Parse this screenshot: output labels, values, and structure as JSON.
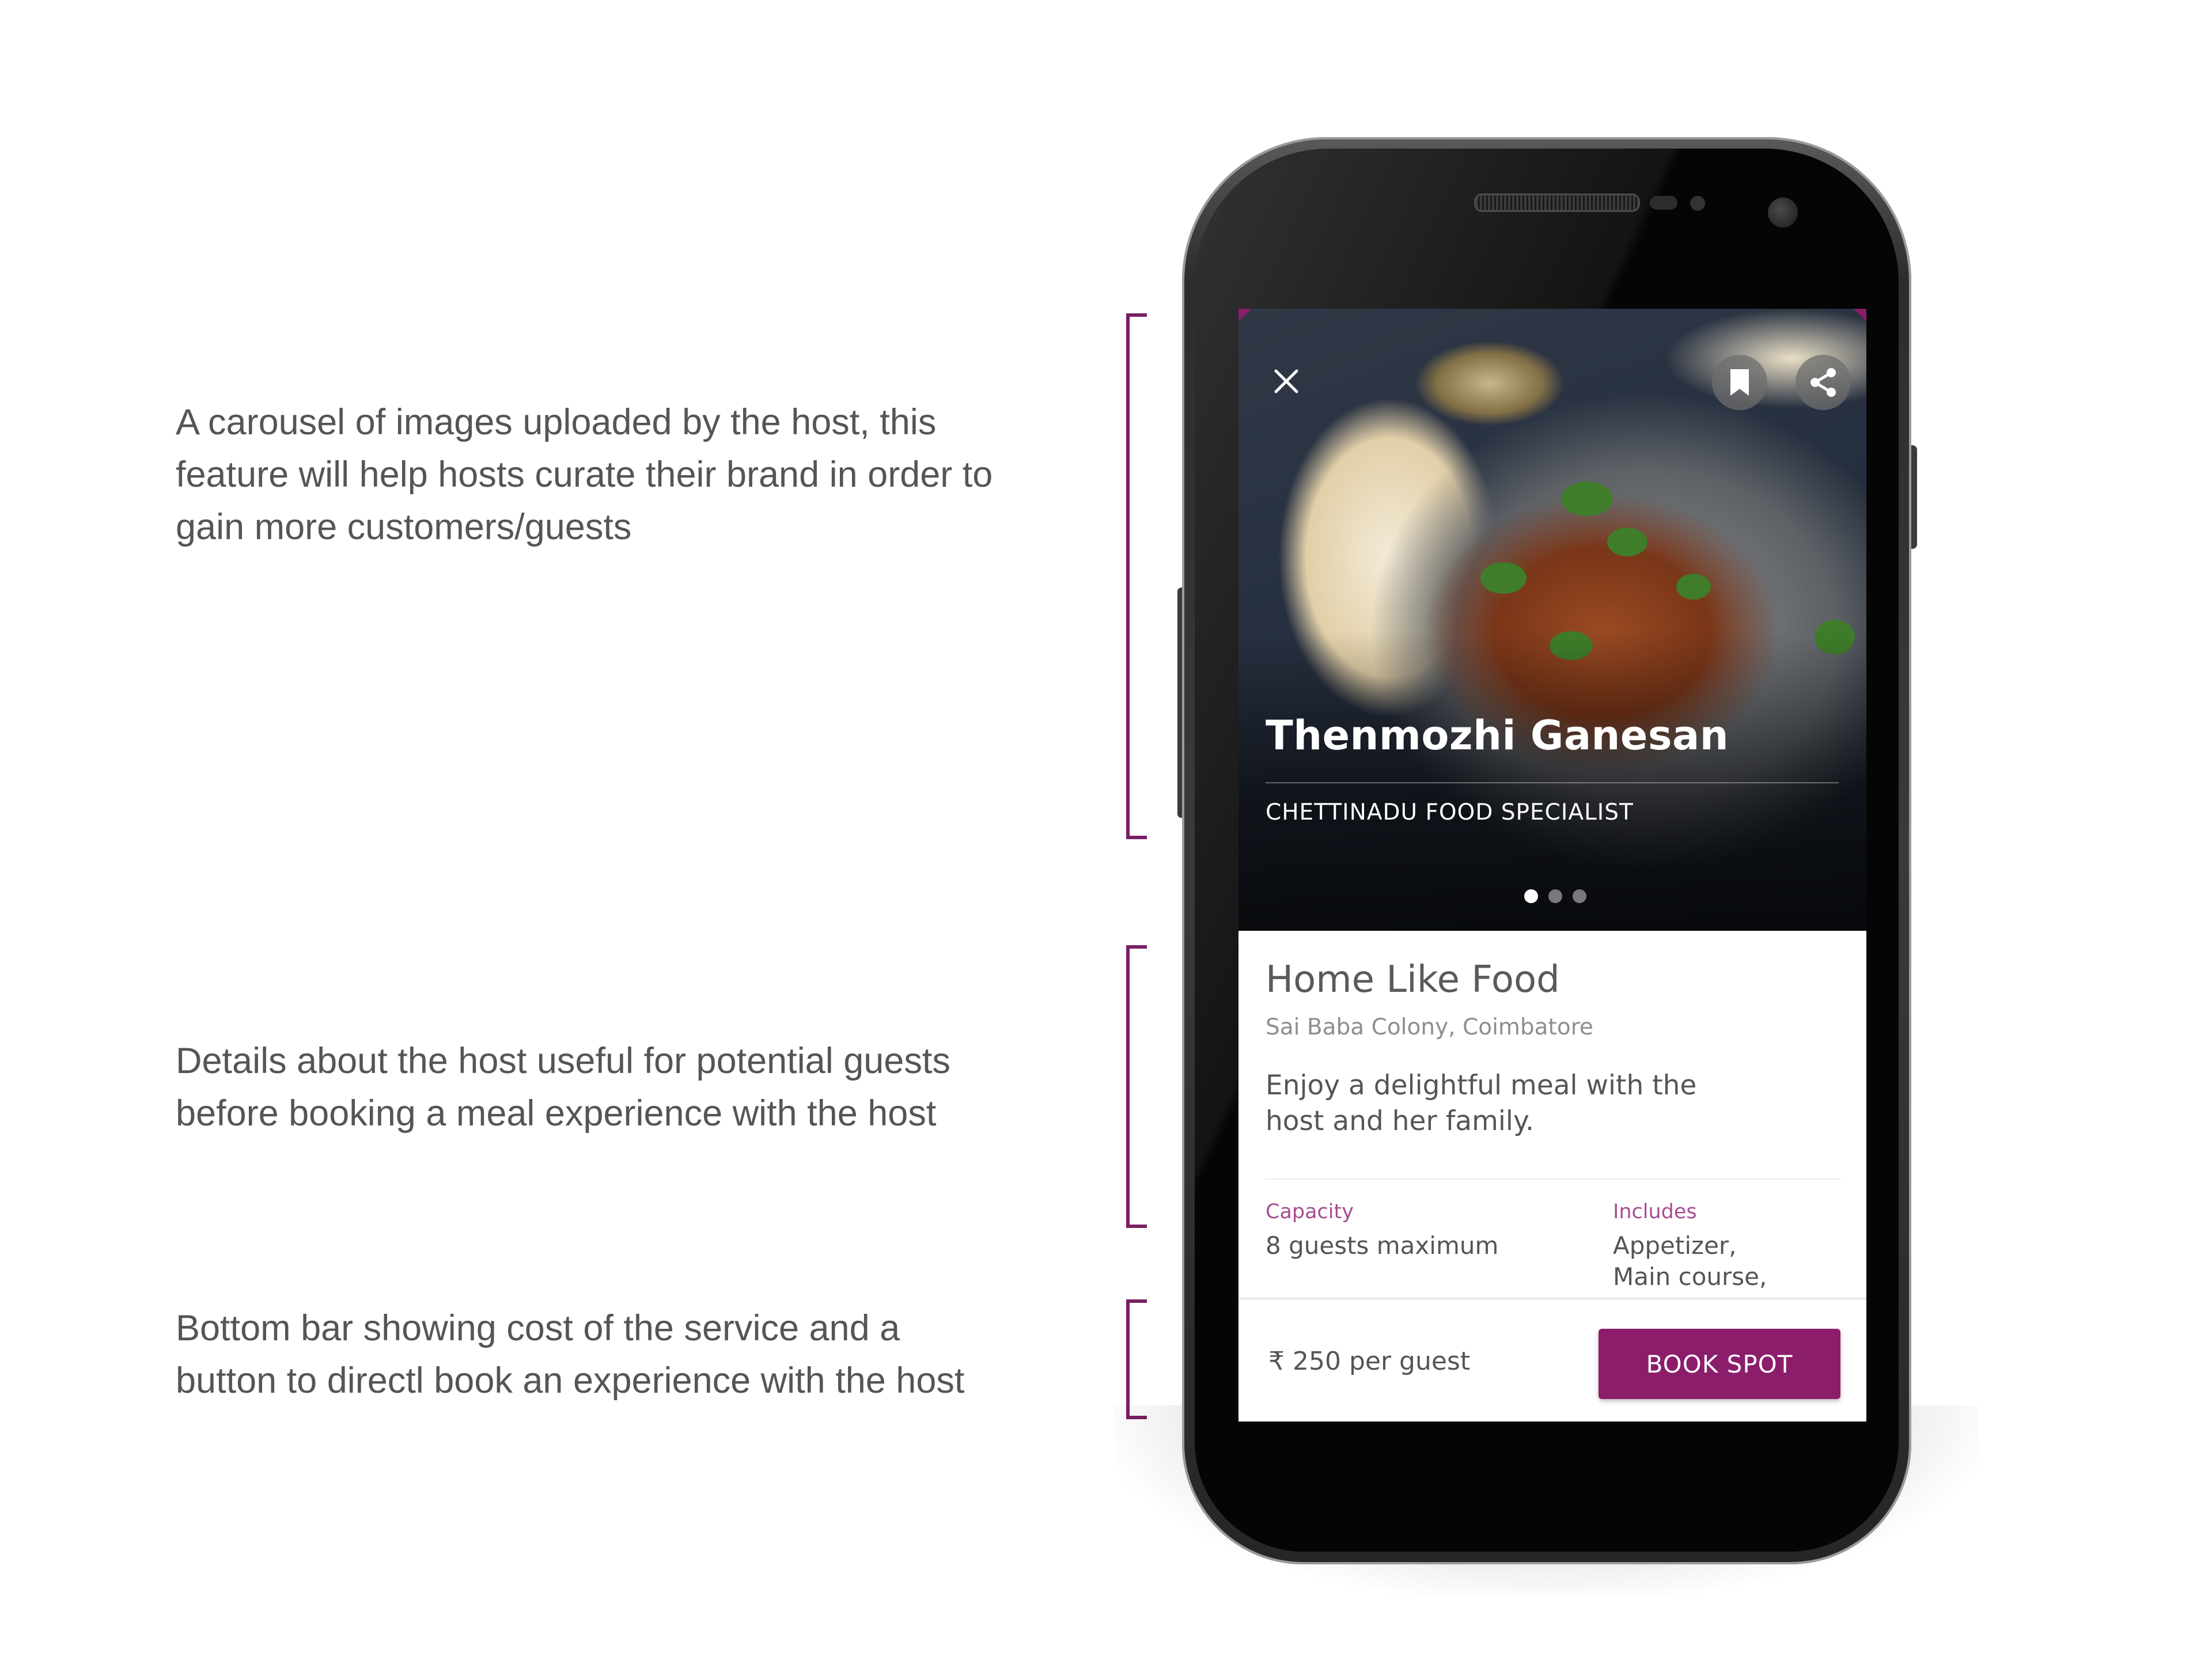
{
  "annotations": {
    "carousel": "A carousel of images uploaded by the host, this\nfeature will help hosts curate their brand in order to\ngain more customers/guests",
    "details": "Details about the host useful for potential guests\nbefore booking a meal experience with the host",
    "bottom_bar": "Bottom bar showing cost of the service and a\nbutton to directl book an experience with the host"
  },
  "hero": {
    "host_name": "Thenmozhi Ganesan",
    "host_role": "CHETTINADU FOOD SPECIALIST",
    "carousel": {
      "total": 3,
      "active": 1
    }
  },
  "icons": {
    "close": "close-icon",
    "bookmark": "bookmark-icon",
    "share": "share-icon"
  },
  "details": {
    "title": "Home Like Food",
    "location": "Sai Baba Colony, Coimbatore",
    "description": "Enjoy a delightful meal with the\nhost and her family.",
    "capacity_label": "Capacity",
    "capacity_value": "8 guests maximum",
    "includes_label": "Includes",
    "includes_value": "Appetizer,\nMain course,"
  },
  "bottom_bar": {
    "price": "₹ 250 per guest",
    "book_label": "BOOK SPOT"
  },
  "colors": {
    "accent": "#8b1d6b",
    "label": "#a64d92",
    "bracket": "#7a1f62"
  }
}
